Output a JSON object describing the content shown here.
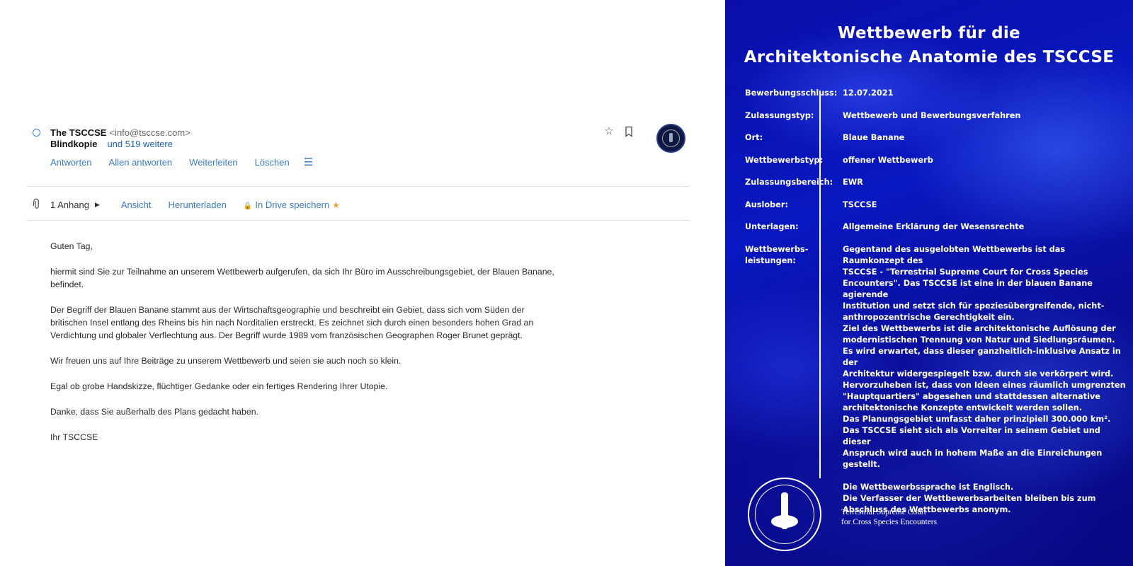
{
  "mail": {
    "sender_name": "The TSCCSE",
    "sender_address": "<info@tsccse.com>",
    "bcc_label": "Blindkopie",
    "more_recipients": "und 519 weitere",
    "icons": [
      "star-icon",
      "bookmark-icon"
    ],
    "actions": [
      "Antworten",
      "Allen antworten",
      "Weiterleiten",
      "Löschen"
    ],
    "attachments": {
      "count_label": "1 Anhang",
      "view_label": "Ansicht",
      "download_label": "Herunterladen",
      "drive_label": "In Drive speichern"
    },
    "body": [
      "Guten Tag,",
      "hiermit sind Sie zur Teilnahme an unserem Wettbewerb aufgerufen, da sich Ihr Büro im Ausschreibungsgebiet, der Blauen Banane, befindet.",
      "Der Begriff der Blauen Banane stammt aus der Wirtschaftsgeographie und beschreibt ein Gebiet, dass sich vom Süden der britischen Insel entlang des Rheins bis hin nach Norditalien erstreckt. Es zeichnet sich durch einen besonders hohen Grad an Verdichtung und globaler Verflechtung aus. Der Begriff wurde 1989 vom französischen Geographen Roger Brunet geprägt.",
      "Wir freuen uns auf Ihre Beiträge zu unserem Wettbewerb und seien sie auch noch so klein.",
      "Egal ob grobe Handskizze, flüchtiger Gedanke oder ein fertiges Rendering Ihrer Utopie.",
      "Danke, dass Sie außerhalb des Plans gedacht haben.",
      "Ihr TSCCSE"
    ]
  },
  "poster": {
    "title_line1": "Wettbewerb für die",
    "title_line2": "Architektonische Anatomie des TSCCSE",
    "rows": [
      {
        "key": "Bewerbungsschluss:",
        "value": "12.07.2021"
      },
      {
        "key": "Zulassungstyp:",
        "value": "Wettbewerb und Bewerbungsverfahren"
      },
      {
        "key": "Ort:",
        "value": "Blaue Banane"
      },
      {
        "key": "Wettbewerbstyp:",
        "value": "offener Wettbewerb"
      },
      {
        "key": "Zulassungsbereich:",
        "value": "EWR"
      },
      {
        "key": "Auslober:",
        "value": "TSCCSE"
      },
      {
        "key": "Unterlagen:",
        "value": "Allgemeine Erklärung der Wesensrechte"
      }
    ],
    "leistungen_key_line1": "Wettbewerbs-",
    "leistungen_key_line2": "leistungen:",
    "leistungen_lines": [
      "Gegentand des ausgelobten Wettbewerbs ist das Raumkonzept des",
      "TSCCSE - \"Terrestrial Supreme Court for Cross Species",
      "Encounters\". Das TSCCSE ist eine in der blauen Banane agierende",
      "Institution und setzt sich für speziesübergreifende, nicht-",
      "anthropozentrische Gerechtigkeit ein.",
      "Ziel des Wettbewerbs ist die architektonische Auflösung der",
      "modernistischen Trennung von Natur und Siedlungsräumen.",
      "Es wird erwartet, dass dieser ganzheitlich-inklusive Ansatz in der",
      "Architektur widergespiegelt bzw. durch sie verkörpert wird.",
      "Hervorzuheben ist, dass von Ideen eines räumlich umgrenzten",
      "\"Hauptquartiers\" abgesehen und stattdessen alternative",
      "architektonische Konzepte entwickelt werden sollen.",
      "Das Planungsgebiet umfasst daher prinzipiell 300.000 km².",
      "Das TSCCSE sieht sich als Vorreiter in seinem Gebiet und dieser",
      "Anspruch wird auch in hohem Maße an die Einreichungen gestellt.",
      "",
      "Die Wettbewerbssprache ist Englisch.",
      "Die Verfasser der Wettbewerbsarbeiten bleiben bis zum",
      "Abschluss des Wettbewerbs anonym."
    ],
    "seal_text": "TERRESTRIAL · SUPREME COURT FOR CROSS SPECIES ENCOUNTERS",
    "court_line1": "Terrestrial Supreme Court",
    "court_line2": "for Cross Species Encounters"
  }
}
